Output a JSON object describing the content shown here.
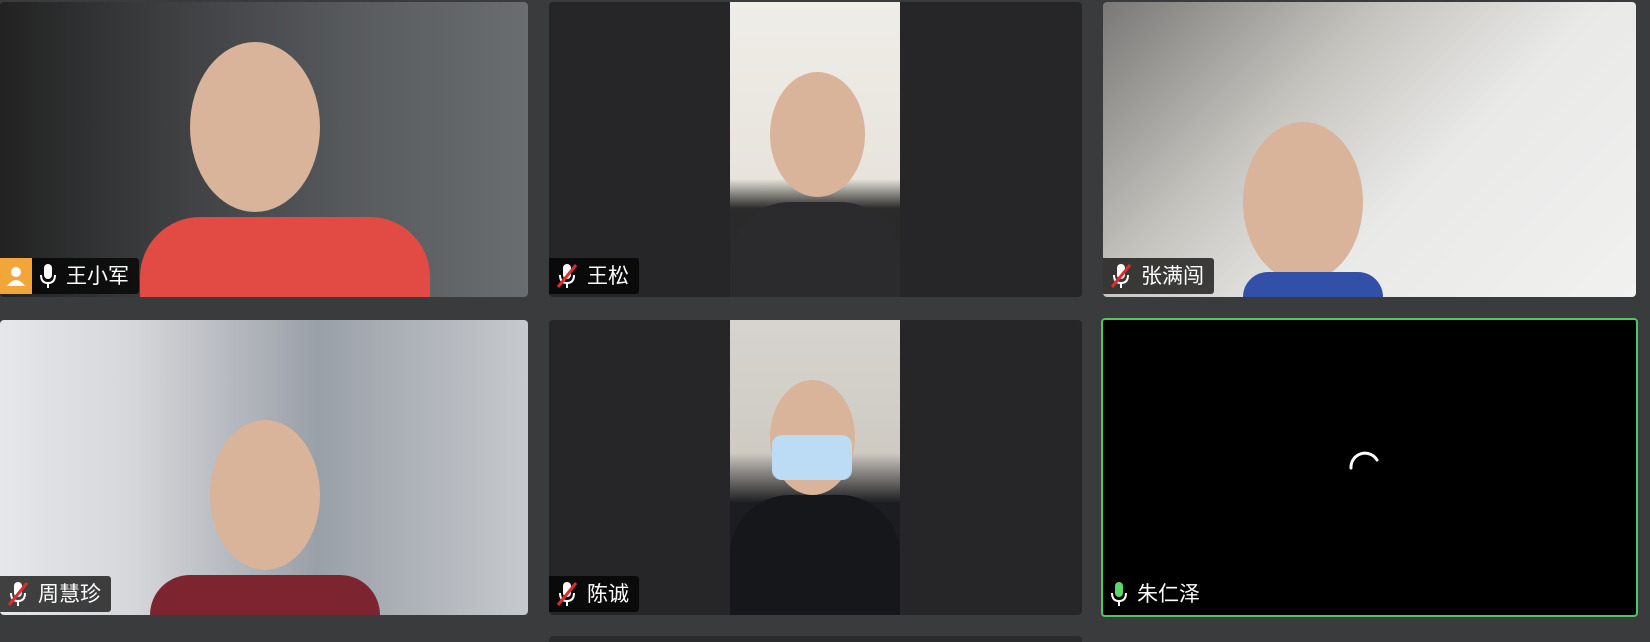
{
  "participants": [
    {
      "name": "王小军",
      "mic": "on",
      "host": true
    },
    {
      "name": "王松",
      "mic": "muted"
    },
    {
      "name": "张满闯",
      "mic": "muted"
    },
    {
      "name": "周慧珍",
      "mic": "muted"
    },
    {
      "name": "陈诚",
      "mic": "muted"
    },
    {
      "name": "朱仁泽",
      "mic": "on",
      "active_speaker": true,
      "video": "loading"
    }
  ],
  "colors": {
    "background": "#3a3b3d",
    "active_speaker_border": "#4fc660",
    "host_badge": "#f2a63a"
  }
}
